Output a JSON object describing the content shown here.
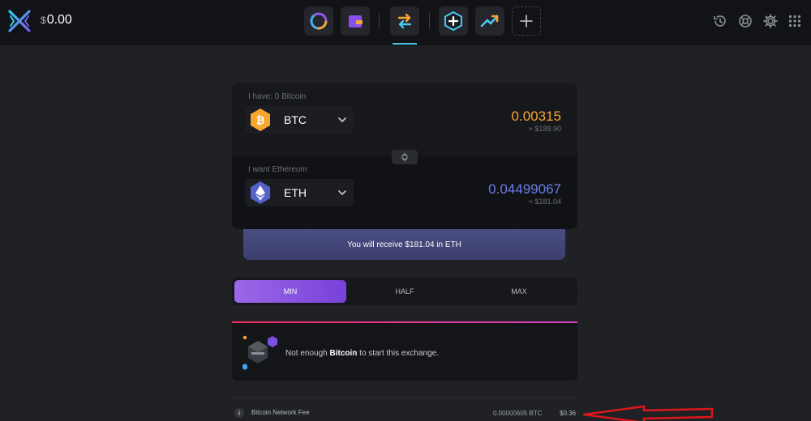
{
  "header": {
    "balance_currency": "$",
    "balance_amount": "0.00",
    "nav_icons": [
      "portfolio-ring-icon",
      "wallet-icon",
      "exchange-icon",
      "backup-icon",
      "trend-icon",
      "add-icon"
    ],
    "right_icons": [
      "history-icon",
      "support-icon",
      "settings-icon",
      "apps-icon"
    ],
    "accent_color": "#49c8f0"
  },
  "exchange": {
    "have_label": "I have: 0 Bitcoin",
    "from_ticker": "BTC",
    "from_amount": "0.00315",
    "from_fiat": "≈ $188.90",
    "want_label": "I want Ethereum",
    "to_ticker": "ETH",
    "to_amount": "0.04499067",
    "to_fiat": "≈ $181.04",
    "receive_text": "You will receive $181.04 in ETH",
    "btc_color": "#f7a72f",
    "eth_color": "#6b7fe8"
  },
  "choices": {
    "min": "MIN",
    "half": "HALF",
    "max": "MAX",
    "selected": "MIN"
  },
  "warning": {
    "prefix": "Not enough ",
    "coin": "Bitcoin",
    "suffix": " to start this exchange."
  },
  "fee": {
    "info": "i",
    "label": "Bitcoin Network Fee",
    "crypto": "0.00000605 BTC",
    "fiat": "$0.36"
  },
  "annotation": {
    "arrow_color": "#e0161c"
  }
}
